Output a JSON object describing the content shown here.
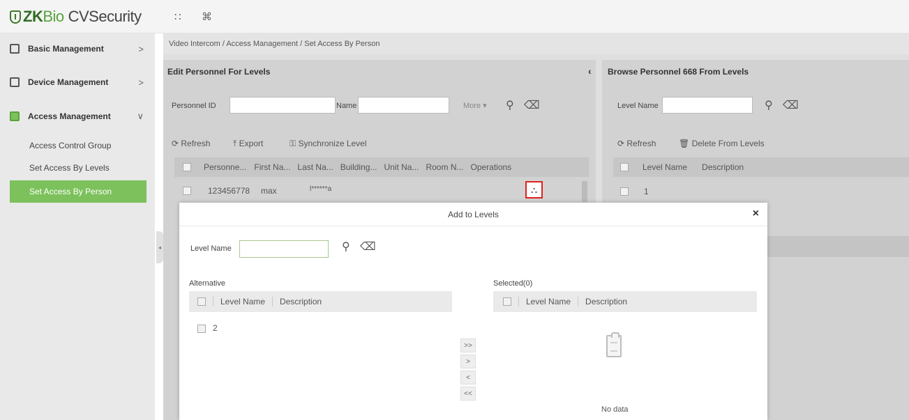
{
  "app": {
    "logo_zk": "ZK",
    "logo_bio": "Bio",
    "logo_cv": "CVSecurity",
    "top_icons": [
      "apps-grid-icon",
      "command-icon"
    ],
    "top_icon_glyphs": [
      "∷",
      "⌘"
    ]
  },
  "sidebar": {
    "menus": [
      {
        "label": "Basic Management",
        "chevron": ">"
      },
      {
        "label": "Device Management",
        "chevron": ">"
      },
      {
        "label": "Access Management",
        "chevron": "∨"
      }
    ],
    "sub_items": [
      {
        "label": "Access Control Group"
      },
      {
        "label": "Set Access By Levels"
      },
      {
        "label": "Set Access By Person"
      }
    ],
    "active_color": "#7cc15b"
  },
  "breadcrumb": "Video Intercom / Access Management / Set Access By Person",
  "left_panel": {
    "title": "Edit Personnel For Levels",
    "collapse_arrow": "‹",
    "personnel_id_label": "Personnel ID",
    "name_label": "Name",
    "more_label": "More ▾",
    "toolbar": {
      "refresh": "Refresh",
      "export": "Export",
      "sync": "Synchronize Level"
    },
    "columns": [
      "Personne...",
      "First Na...",
      "Last Na...",
      "Building...",
      "Unit Na...",
      "Room N...",
      "Operations"
    ],
    "rows": [
      {
        "personnel_id": "123456778",
        "first_name": "max",
        "last_name": "l******a"
      }
    ]
  },
  "right_panel": {
    "title": "Browse Personnel 668 From Levels",
    "level_name_label": "Level Name",
    "toolbar": {
      "refresh": "Refresh",
      "delete": "Delete From Levels"
    },
    "columns": [
      "Level Name",
      "Description"
    ],
    "rows": [
      {
        "level_name": "1"
      }
    ]
  },
  "modal": {
    "title": "Add to Levels",
    "close": "×",
    "level_name_label": "Level Name",
    "alternative_label": "Alternative",
    "selected_label": "Selected(0)",
    "columns": [
      "Level Name",
      "Description"
    ],
    "alternative_rows": [
      {
        "level_name": "2"
      }
    ],
    "move_buttons": [
      ">>",
      ">",
      "<",
      "<<"
    ],
    "no_data": "No data"
  },
  "colors": {
    "accent_green": "#7cc15b",
    "highlight_red": "#e02020"
  }
}
